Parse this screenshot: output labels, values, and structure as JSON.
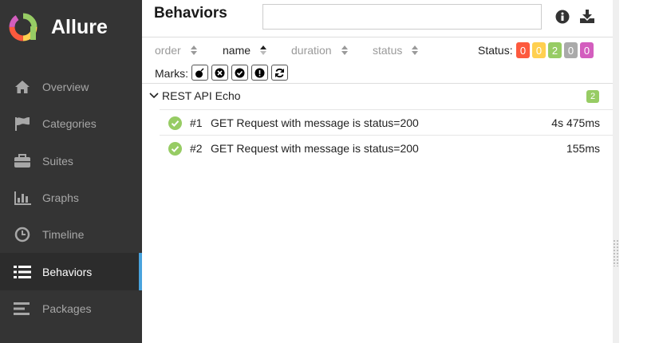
{
  "app": {
    "name": "Allure"
  },
  "sidebar": {
    "items": [
      {
        "label": "Overview",
        "icon": "home-icon"
      },
      {
        "label": "Categories",
        "icon": "flag-icon"
      },
      {
        "label": "Suites",
        "icon": "briefcase-icon"
      },
      {
        "label": "Graphs",
        "icon": "bar-chart-icon"
      },
      {
        "label": "Timeline",
        "icon": "clock-icon"
      },
      {
        "label": "Behaviors",
        "icon": "list-icon",
        "active": true
      },
      {
        "label": "Packages",
        "icon": "align-left-icon"
      }
    ]
  },
  "main": {
    "title": "Behaviors",
    "search": {
      "value": "",
      "placeholder": ""
    },
    "sorters": [
      "order",
      "name",
      "duration",
      "status"
    ],
    "active_sorter": "name",
    "status_label": "Status:",
    "status_counts": [
      {
        "value": "0",
        "color": "#fd5a3e"
      },
      {
        "value": "0",
        "color": "#ffd050"
      },
      {
        "value": "2",
        "color": "#97cc64"
      },
      {
        "value": "0",
        "color": "#aaaaaa"
      },
      {
        "value": "0",
        "color": "#d35ebe"
      }
    ],
    "marks_label": "Marks:",
    "marks": [
      "bomb-icon",
      "times-circle-icon",
      "check-circle-icon",
      "exclamation-circle-icon",
      "refresh-icon"
    ],
    "group": {
      "name": "REST API Echo",
      "count": "2"
    },
    "tests": [
      {
        "num": "#1",
        "name": "GET Request with message is status=200",
        "duration": "4s 475ms"
      },
      {
        "num": "#2",
        "name": "GET Request with message is status=200",
        "duration": "155ms"
      }
    ]
  },
  "colors": {
    "sidebar_bg": "#343434",
    "active_accent": "#49a3dd",
    "passed": "#97cc64"
  }
}
